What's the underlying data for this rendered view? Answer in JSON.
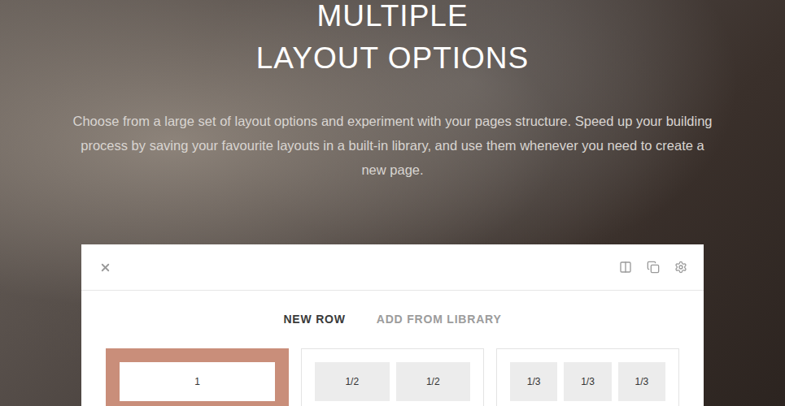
{
  "hero": {
    "title_lines": [
      "MULTIPLE",
      "LAYOUT OPTIONS"
    ],
    "description": "Choose from a large set of layout options and experiment with your pages structure. Speed up your building process by saving your favourite layouts in a built-in library, and use them whenever you need to create a new page."
  },
  "panel": {
    "tabs": [
      {
        "label": "NEW ROW",
        "selected": true
      },
      {
        "label": "ADD FROM LIBRARY",
        "selected": false
      }
    ],
    "layouts": [
      {
        "cells": [
          "1"
        ],
        "selected": true
      },
      {
        "cells": [
          "1/2",
          "1/2"
        ],
        "selected": false
      },
      {
        "cells": [
          "1/3",
          "1/3",
          "1/3"
        ],
        "selected": false
      }
    ]
  }
}
